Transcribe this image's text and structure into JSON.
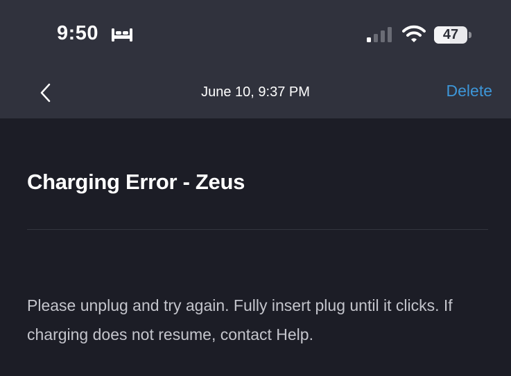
{
  "status_bar": {
    "time": "9:50",
    "focus_icon": "bed-icon",
    "signal_icon": "cellular-signal-icon",
    "wifi_icon": "wifi-icon",
    "battery_level": "47",
    "battery_fraction": 0.47
  },
  "nav": {
    "back_icon": "chevron-left-icon",
    "title": "June 10, 9:37 PM",
    "delete_label": "Delete"
  },
  "message": {
    "title": "Charging Error - Zeus",
    "body": "Please unplug and try again. Fully insert plug until it clicks. If charging does not resume, contact Help."
  },
  "colors": {
    "header_bg": "#30323d",
    "page_bg": "#1c1d26",
    "accent": "#3d96d8",
    "body_text": "#c4c5cc"
  }
}
